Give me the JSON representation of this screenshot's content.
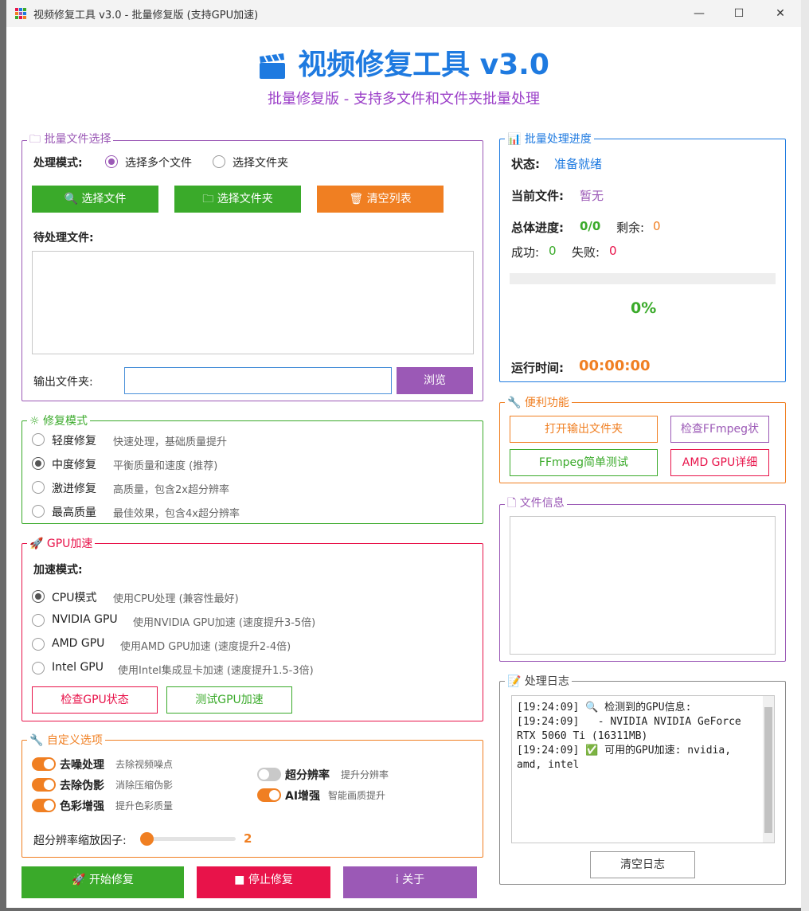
{
  "window": {
    "title": "视频修复工具 v3.0 - 批量修复版 (支持GPU加速)",
    "minimize": "—",
    "maximize": "☐",
    "close": "✕"
  },
  "header": {
    "title": "视频修复工具 v3.0",
    "subtitle": "批量修复版 - 支持多文件和文件夹批量处理"
  },
  "file_select": {
    "legend": "批量文件选择",
    "mode_label": "处理模式:",
    "mode_files": "选择多个文件",
    "mode_folder": "选择文件夹",
    "btn_select_files": "选择文件",
    "btn_select_folder": "选择文件夹",
    "btn_clear": "清空列表",
    "pending_label": "待处理文件:",
    "output_label": "输出文件夹:",
    "output_value": "",
    "btn_browse": "浏览"
  },
  "repair_mode": {
    "legend": "修复模式",
    "options": [
      {
        "name": "轻度修复",
        "desc": "快速处理，基础质量提升"
      },
      {
        "name": "中度修复",
        "desc": "平衡质量和速度 (推荐)"
      },
      {
        "name": "激进修复",
        "desc": "高质量，包含2x超分辨率"
      },
      {
        "name": "最高质量",
        "desc": "最佳效果，包含4x超分辨率"
      }
    ]
  },
  "gpu": {
    "legend": "GPU加速",
    "mode_label": "加速模式:",
    "options": [
      {
        "name": "CPU模式",
        "desc": "使用CPU处理 (兼容性最好)"
      },
      {
        "name": "NVIDIA GPU",
        "desc": "使用NVIDIA GPU加速 (速度提升3-5倍)"
      },
      {
        "name": "AMD GPU",
        "desc": "使用AMD GPU加速 (速度提升2-4倍)"
      },
      {
        "name": "Intel GPU",
        "desc": "使用Intel集成显卡加速 (速度提升1.5-3倍)"
      }
    ],
    "btn_check": "检查GPU状态",
    "btn_test": "测试GPU加速"
  },
  "custom": {
    "legend": "自定义选项",
    "left": [
      {
        "name": "去噪处理",
        "desc": "去除视频噪点"
      },
      {
        "name": "去除伪影",
        "desc": "消除压缩伪影"
      },
      {
        "name": "色彩增强",
        "desc": "提升色彩质量"
      }
    ],
    "right": [
      {
        "name": "超分辨率",
        "desc": "提升分辨率"
      },
      {
        "name": "AI增强",
        "desc": "智能画质提升"
      }
    ],
    "scale_label": "超分辨率缩放因子:",
    "scale_value": "2"
  },
  "bottom_buttons": {
    "start": "开始修复",
    "stop": "停止修复",
    "about": "关于"
  },
  "progress": {
    "legend": "批量处理进度",
    "status_label": "状态:",
    "status_value": "准备就绪",
    "current_label": "当前文件:",
    "current_value": "暂无",
    "total_label": "总体进度:",
    "total_value": "0/0",
    "remain_label": "剩余:",
    "remain_value": "0",
    "success_label": "成功:",
    "success_value": "0",
    "fail_label": "失败:",
    "fail_value": "0",
    "percent": "0%",
    "fraction": 0,
    "runtime_label": "运行时间:",
    "runtime_value": "00:00:00"
  },
  "tools": {
    "legend": "便利功能",
    "btn_open_output": "打开输出文件夹",
    "btn_check_ffmpeg": "检查FFmpeg状",
    "btn_ffmpeg_test": "FFmpeg简单测试",
    "btn_amd_detail": "AMD GPU详细"
  },
  "file_info": {
    "legend": "文件信息"
  },
  "log": {
    "legend": "处理日志",
    "lines": [
      "[19:24:09] 🔍 检测到的GPU信息:",
      "[19:24:09]   - NVIDIA NVIDIA GeForce",
      "RTX 5060 Ti (16311MB)",
      "[19:24:09] ✅ 可用的GPU加速: nvidia,",
      "amd, intel"
    ],
    "btn_clear": "清空日志"
  },
  "colors": {
    "purple": "#9b59b6",
    "green": "#3aaa2a",
    "orange": "#f07f22",
    "red": "#e8134a",
    "blue": "#1e7ae0"
  }
}
